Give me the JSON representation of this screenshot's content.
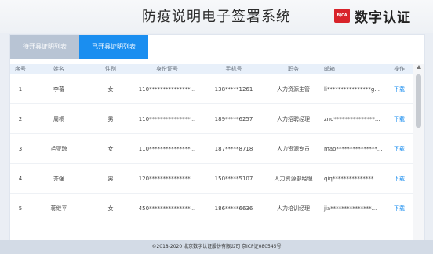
{
  "header": {
    "title": "防疫说明电子签署系统",
    "logo_badge": "BJCA",
    "logo_text": "数字认证"
  },
  "tabs": [
    {
      "label": "待开具证明列表",
      "active": false
    },
    {
      "label": "已开具证明列表",
      "active": true
    }
  ],
  "table": {
    "columns": [
      "序号",
      "姓名",
      "性别",
      "身份证号",
      "手机号",
      "职务",
      "邮箱",
      "操作"
    ],
    "rows": [
      {
        "idx": "1",
        "name": "李蕃",
        "sex": "女",
        "id": "110***************...",
        "phone": "138*****1261",
        "job": "人力资源主管",
        "mail": "li****************g...",
        "op": "下载"
      },
      {
        "idx": "2",
        "name": "周桐",
        "sex": "男",
        "id": "110***************...",
        "phone": "189*****6257",
        "job": "人力招聘经理",
        "mail": "zno***************...",
        "op": "下载"
      },
      {
        "idx": "3",
        "name": "毛亚琼",
        "sex": "女",
        "id": "110***************...",
        "phone": "187*****8718",
        "job": "人力资源专员",
        "mail": "mao***************...",
        "op": "下载"
      },
      {
        "idx": "4",
        "name": "齐强",
        "sex": "男",
        "id": "120***************...",
        "phone": "150*****5107",
        "job": "人力资源部经理",
        "mail": "qiq***************...",
        "op": "下载"
      },
      {
        "idx": "5",
        "name": "蒋继平",
        "sex": "女",
        "id": "450***************...",
        "phone": "186*****6636",
        "job": "人力培训经理",
        "mail": "jia***************...",
        "op": "下载"
      }
    ]
  },
  "footer": {
    "text": "©2018-2020 北京数字认证股份有限公司  京ICP证080545号"
  }
}
